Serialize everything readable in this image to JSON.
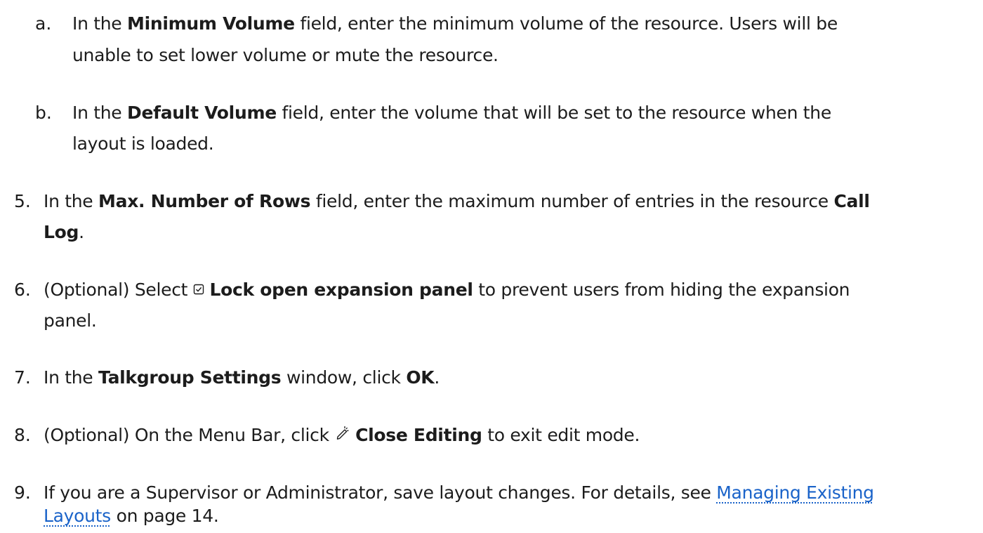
{
  "steps": {
    "a": {
      "marker": "a.",
      "t1": "In the ",
      "b1": "Minimum Volume",
      "t2": " field, enter the minimum volume of the resource. Users will be",
      "t3": "unable to set lower volume or mute the resource."
    },
    "b": {
      "marker": "b.",
      "t1": "In the ",
      "b1": "Default Volume",
      "t2": " field, enter the volume that will be set to the resource when the",
      "t3": "layout is loaded."
    },
    "s5": {
      "marker": "5.",
      "t1": "In the ",
      "b1": "Max. Number of Rows",
      "t2": " field, enter the maximum number of entries in the resource ",
      "b2": "Call",
      "b3": "Log",
      "t3": "."
    },
    "s6": {
      "marker": "6.",
      "t1": "(Optional) Select ",
      "b1": "Lock open expansion panel",
      "t2": " to prevent users from hiding the expansion",
      "t3": "panel."
    },
    "s7": {
      "marker": "7.",
      "t1": "In the ",
      "b1": "Talkgroup Settings",
      "t2": " window, click ",
      "b2": "OK",
      "t3": "."
    },
    "s8": {
      "marker": "8.",
      "t1": "(Optional) On the Menu Bar, click ",
      "b1": "Close Editing",
      "t2": " to exit edit mode."
    },
    "s9": {
      "marker": "9.",
      "t1": "If you are a Supervisor or Administrator, save layout changes. For details, see ",
      "link1": "Managing Existing",
      "link2": "Layouts",
      "t2": " on page 14."
    }
  },
  "icons": {
    "checkbox": "checkbox-checked-icon",
    "edit": "close-editing-icon"
  },
  "colors": {
    "text": "#1c1c1c",
    "link": "#1a63c9"
  }
}
